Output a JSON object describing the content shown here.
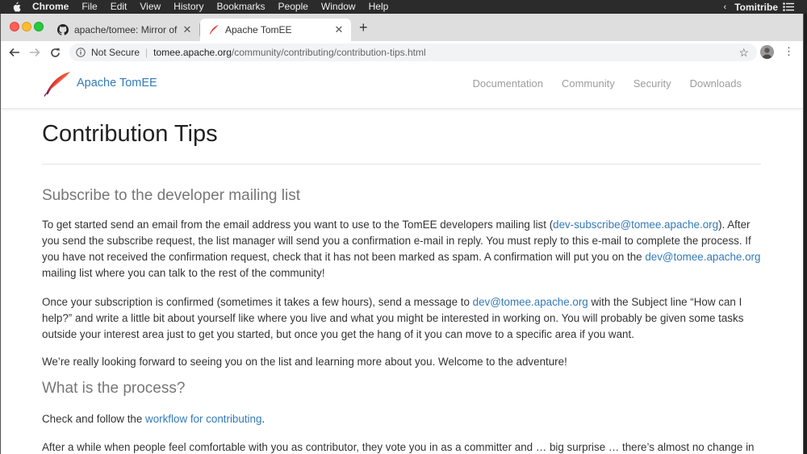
{
  "menubar": {
    "app": "Chrome",
    "items": [
      "File",
      "Edit",
      "View",
      "History",
      "Bookmarks",
      "People",
      "Window",
      "Help"
    ],
    "user": "Tomitribe"
  },
  "tabs": [
    {
      "title": "apache/tomee: Mirror of",
      "icon": "github-icon",
      "active": false
    },
    {
      "title": "Apache TomEE",
      "icon": "feather-icon",
      "active": true
    }
  ],
  "omnibox": {
    "security": "Not Secure",
    "domain": "tomee.apache.org",
    "path": "/community/contributing/contribution-tips.html"
  },
  "site": {
    "brand": "Apache TomEE",
    "nav": [
      "Documentation",
      "Community",
      "Security",
      "Downloads"
    ]
  },
  "content": {
    "title": "Contribution Tips",
    "sections": {
      "subscribe_heading": "Subscribe to the developer mailing list",
      "p1": {
        "t1": "To get started send an email from the email address you want to use to the TomEE developers mailing list (",
        "link1": "dev-subscribe@tomee.apache.org",
        "t2": "). After you send the subscribe request, the list manager will send you a confirmation e-mail in reply. You must reply to this e-mail to complete the process. If you have not received the confirmation request, check that it has not been marked as spam. A confirmation will put you on the ",
        "link2": "dev@tomee.apache.org",
        "t3": " mailing list where you can talk to the rest of the community!"
      },
      "p2": {
        "t1": "Once your subscription is confirmed (sometimes it takes a few hours), send a message to ",
        "link1": "dev@tomee.apache.org",
        "t2": " with the Subject line “How can I help?” and write a little bit about yourself like where you live and what you might be interested in working on. You will probably be given some tasks outside your interest area just to get you started, but once you get the hang of it you can move to a specific area if you want."
      },
      "p3": "We’re really looking forward to seeing you on the list and learning more about you. Welcome to the adventure!",
      "process_heading": "What is the process?",
      "p4": {
        "t1": "Check and follow the ",
        "link1": "workflow for contributing",
        "t2": "."
      },
      "p5": "After a while when people feel comfortable with you as contributor, they vote you in as a committer and … big surprise … there’s almost no change in"
    }
  }
}
